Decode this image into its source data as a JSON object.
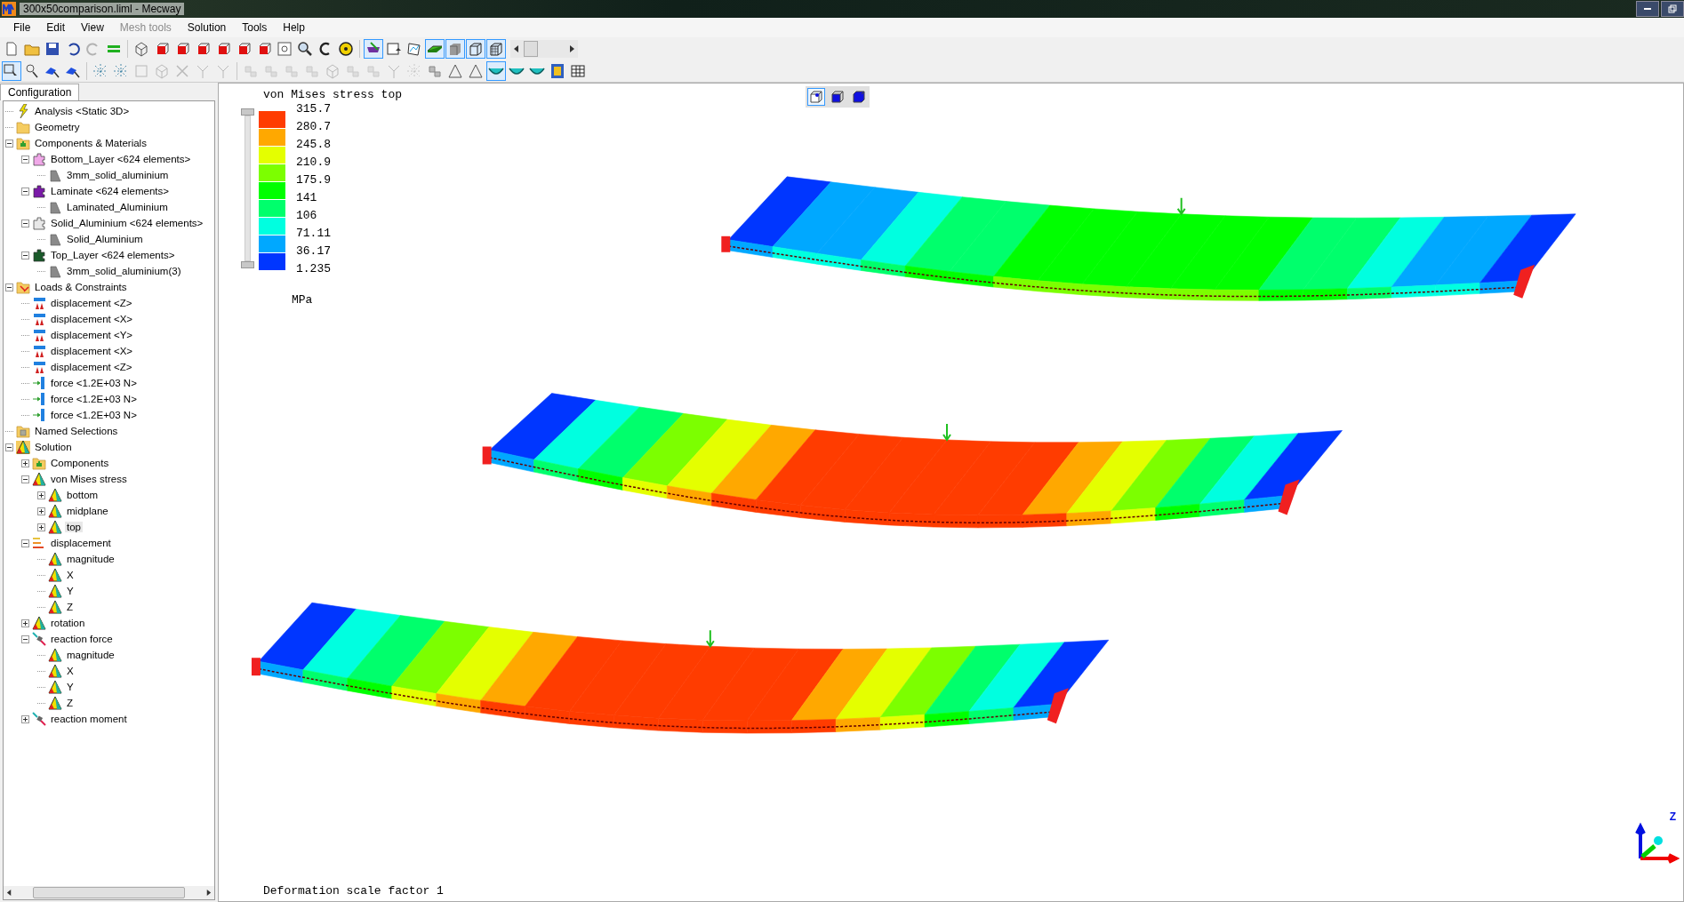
{
  "window": {
    "title": "300x50comparison.liml - Mecway"
  },
  "menu": [
    {
      "label": "File",
      "disabled": false
    },
    {
      "label": "Edit",
      "disabled": false
    },
    {
      "label": "View",
      "disabled": false
    },
    {
      "label": "Mesh tools",
      "disabled": true
    },
    {
      "label": "Solution",
      "disabled": false
    },
    {
      "label": "Tools",
      "disabled": false
    },
    {
      "label": "Help",
      "disabled": false
    }
  ],
  "toolbars": [
    [
      {
        "kind": "page",
        "pressed": false,
        "disabled": false
      },
      {
        "kind": "folder",
        "pressed": false,
        "disabled": false
      },
      {
        "kind": "disk",
        "pressed": false,
        "disabled": false
      },
      {
        "kind": "undo",
        "pressed": false,
        "disabled": false
      },
      {
        "kind": "redo",
        "pressed": false,
        "disabled": true
      },
      {
        "kind": "bars",
        "pressed": false,
        "disabled": false,
        "gap_after": true
      },
      {
        "kind": "cube",
        "pressed": false,
        "disabled": false
      },
      {
        "kind": "cube-face",
        "pressed": false,
        "disabled": false
      },
      {
        "kind": "cube-face",
        "pressed": false,
        "disabled": false
      },
      {
        "kind": "cube-face",
        "pressed": false,
        "disabled": false
      },
      {
        "kind": "cube-face",
        "pressed": false,
        "disabled": false
      },
      {
        "kind": "cube-face",
        "pressed": false,
        "disabled": false
      },
      {
        "kind": "cube-face",
        "pressed": false,
        "disabled": false
      },
      {
        "kind": "zoom-box",
        "pressed": false,
        "disabled": false
      },
      {
        "kind": "magnify",
        "pressed": false,
        "disabled": false
      },
      {
        "kind": "rotate",
        "pressed": false,
        "disabled": false
      },
      {
        "kind": "tape",
        "pressed": false,
        "disabled": false,
        "gap_after": true
      },
      {
        "kind": "mask",
        "pressed": true,
        "disabled": false
      },
      {
        "kind": "view",
        "pressed": false,
        "disabled": false
      },
      {
        "kind": "chart",
        "pressed": false,
        "disabled": false
      },
      {
        "kind": "plane",
        "pressed": true,
        "disabled": false
      },
      {
        "kind": "solid",
        "pressed": true,
        "disabled": false
      },
      {
        "kind": "wire",
        "pressed": true,
        "disabled": false
      },
      {
        "kind": "mesh",
        "pressed": true,
        "disabled": false
      }
    ],
    [
      {
        "kind": "select",
        "pressed": true,
        "disabled": false
      },
      {
        "kind": "pick",
        "pressed": false,
        "disabled": false
      },
      {
        "kind": "node",
        "pressed": false,
        "disabled": false
      },
      {
        "kind": "node",
        "pressed": false,
        "disabled": false,
        "gap_after": true
      },
      {
        "kind": "burst",
        "pressed": false,
        "disabled": false
      },
      {
        "kind": "burst",
        "pressed": false,
        "disabled": false
      },
      {
        "kind": "square",
        "pressed": false,
        "disabled": true
      },
      {
        "kind": "cube",
        "pressed": false,
        "disabled": true
      },
      {
        "kind": "cross",
        "pressed": false,
        "disabled": true
      },
      {
        "kind": "fork",
        "pressed": false,
        "disabled": true
      },
      {
        "kind": "fork",
        "pressed": false,
        "disabled": true,
        "gap_after": true
      },
      {
        "kind": "shape",
        "pressed": false,
        "disabled": true
      },
      {
        "kind": "shape",
        "pressed": false,
        "disabled": true
      },
      {
        "kind": "shape",
        "pressed": false,
        "disabled": true
      },
      {
        "kind": "shape",
        "pressed": false,
        "disabled": true
      },
      {
        "kind": "cube",
        "pressed": false,
        "disabled": true
      },
      {
        "kind": "shape",
        "pressed": false,
        "disabled": true
      },
      {
        "kind": "shape",
        "pressed": false,
        "disabled": true
      },
      {
        "kind": "fork",
        "pressed": false,
        "disabled": true
      },
      {
        "kind": "burst",
        "pressed": false,
        "disabled": true
      },
      {
        "kind": "shape",
        "pressed": false,
        "disabled": false
      },
      {
        "kind": "tri",
        "pressed": false,
        "disabled": false
      },
      {
        "kind": "tri",
        "pressed": false,
        "disabled": false
      },
      {
        "kind": "bowl",
        "pressed": true,
        "disabled": false
      },
      {
        "kind": "bowl",
        "pressed": false,
        "disabled": false
      },
      {
        "kind": "bowl",
        "pressed": false,
        "disabled": false
      },
      {
        "kind": "film",
        "pressed": false,
        "disabled": false
      },
      {
        "kind": "grid",
        "pressed": false,
        "disabled": false
      }
    ]
  ],
  "panel_tab": {
    "label": "Configuration",
    "selected": true
  },
  "tree": [
    {
      "label": "Analysis <Static 3D>",
      "kind": "analysis",
      "selected": false
    },
    {
      "label": "Geometry",
      "kind": "folder",
      "selected": false
    },
    {
      "label": "Components & Materials",
      "kind": "components",
      "selected": false,
      "expanded": true,
      "children": [
        {
          "label": "Bottom_Layer <624 elements>",
          "kind": "part",
          "color": "#f0a8e8",
          "selected": false,
          "expanded": true,
          "children": [
            {
              "label": "3mm_solid_aluminium",
              "kind": "material",
              "selected": false
            }
          ]
        },
        {
          "label": "Laminate <624 elements>",
          "kind": "part",
          "color": "#7a1aa8",
          "selected": false,
          "expanded": true,
          "children": [
            {
              "label": "Laminated_Aluminium",
              "kind": "material",
              "selected": false
            }
          ]
        },
        {
          "label": "Solid_Aluminium <624 elements>",
          "kind": "part",
          "color": "#e8e8e8",
          "selected": false,
          "expanded": true,
          "children": [
            {
              "label": "Solid_Aluminium",
              "kind": "material",
              "selected": false
            }
          ]
        },
        {
          "label": "Top_Layer <624 elements>",
          "kind": "part",
          "color": "#1a5a2a",
          "selected": false,
          "expanded": true,
          "children": [
            {
              "label": "3mm_solid_aluminium(3)",
              "kind": "material",
              "selected": false
            }
          ]
        }
      ]
    },
    {
      "label": "Loads & Constraints",
      "kind": "loads",
      "selected": false,
      "expanded": true,
      "children": [
        {
          "label": "displacement <Z>",
          "kind": "constraint",
          "selected": false
        },
        {
          "label": "displacement <X>",
          "kind": "constraint",
          "selected": false
        },
        {
          "label": "displacement <Y>",
          "kind": "constraint",
          "selected": false
        },
        {
          "label": "displacement <X>",
          "kind": "constraint",
          "selected": false
        },
        {
          "label": "displacement <Z>",
          "kind": "constraint",
          "selected": false
        },
        {
          "label": "force <1.2E+03 N>",
          "kind": "force",
          "selected": false
        },
        {
          "label": "force <1.2E+03 N>",
          "kind": "force",
          "selected": false
        },
        {
          "label": "force <1.2E+03 N>",
          "kind": "force",
          "selected": false
        }
      ]
    },
    {
      "label": "Named Selections",
      "kind": "named",
      "selected": false
    },
    {
      "label": "Solution",
      "kind": "solution",
      "selected": false,
      "expanded": true,
      "children": [
        {
          "label": "Components",
          "kind": "components",
          "selected": false,
          "expanded": false
        },
        {
          "label": "von Mises stress",
          "kind": "result",
          "selected": false,
          "expanded": true,
          "children": [
            {
              "label": "bottom",
              "kind": "result",
              "selected": false,
              "expanded": false
            },
            {
              "label": "midplane",
              "kind": "result",
              "selected": false,
              "expanded": false
            },
            {
              "label": "top",
              "kind": "result",
              "selected": true,
              "expanded": false
            }
          ]
        },
        {
          "label": "displacement",
          "kind": "displacement",
          "selected": false,
          "expanded": true,
          "children": [
            {
              "label": "magnitude",
              "kind": "result",
              "selected": false
            },
            {
              "label": "X",
              "kind": "result",
              "selected": false
            },
            {
              "label": "Y",
              "kind": "result",
              "selected": false
            },
            {
              "label": "Z",
              "kind": "result",
              "selected": false
            }
          ]
        },
        {
          "label": "rotation",
          "kind": "result",
          "selected": false,
          "expanded": false
        },
        {
          "label": "reaction force",
          "kind": "reaction",
          "selected": false,
          "expanded": true,
          "children": [
            {
              "label": "magnitude",
              "kind": "result",
              "selected": false
            },
            {
              "label": "X",
              "kind": "result",
              "selected": false
            },
            {
              "label": "Y",
              "kind": "result",
              "selected": false
            },
            {
              "label": "Z",
              "kind": "result",
              "selected": false
            }
          ]
        },
        {
          "label": "reaction moment",
          "kind": "reaction",
          "selected": false,
          "expanded": false
        }
      ]
    }
  ],
  "legend": {
    "title": "von Mises stress top",
    "unit": "MPa",
    "bands": [
      {
        "label": "315.7",
        "color": "#ff3c00"
      },
      {
        "label": "280.7",
        "color": "#ffa800"
      },
      {
        "label": "245.8",
        "color": "#e4ff00"
      },
      {
        "label": "210.9",
        "color": "#7cff00"
      },
      {
        "label": "175.9",
        "color": "#00ff00"
      },
      {
        "label": "141",
        "color": "#00ff6c"
      },
      {
        "label": "106",
        "color": "#00ffe0"
      },
      {
        "label": "71.11",
        "color": "#00a8ff"
      },
      {
        "label": "36.17",
        "color": "#0036ff"
      },
      {
        "label": "1.235"
      }
    ],
    "range_slider": {
      "level": 1
    }
  },
  "view_buttons": [
    {
      "kind": "wire",
      "selected": true
    },
    {
      "kind": "face",
      "selected": false
    },
    {
      "kind": "solid",
      "selected": false
    }
  ],
  "viewport": {
    "footer": "Deformation scale factor 1",
    "axis_label": "Z"
  }
}
